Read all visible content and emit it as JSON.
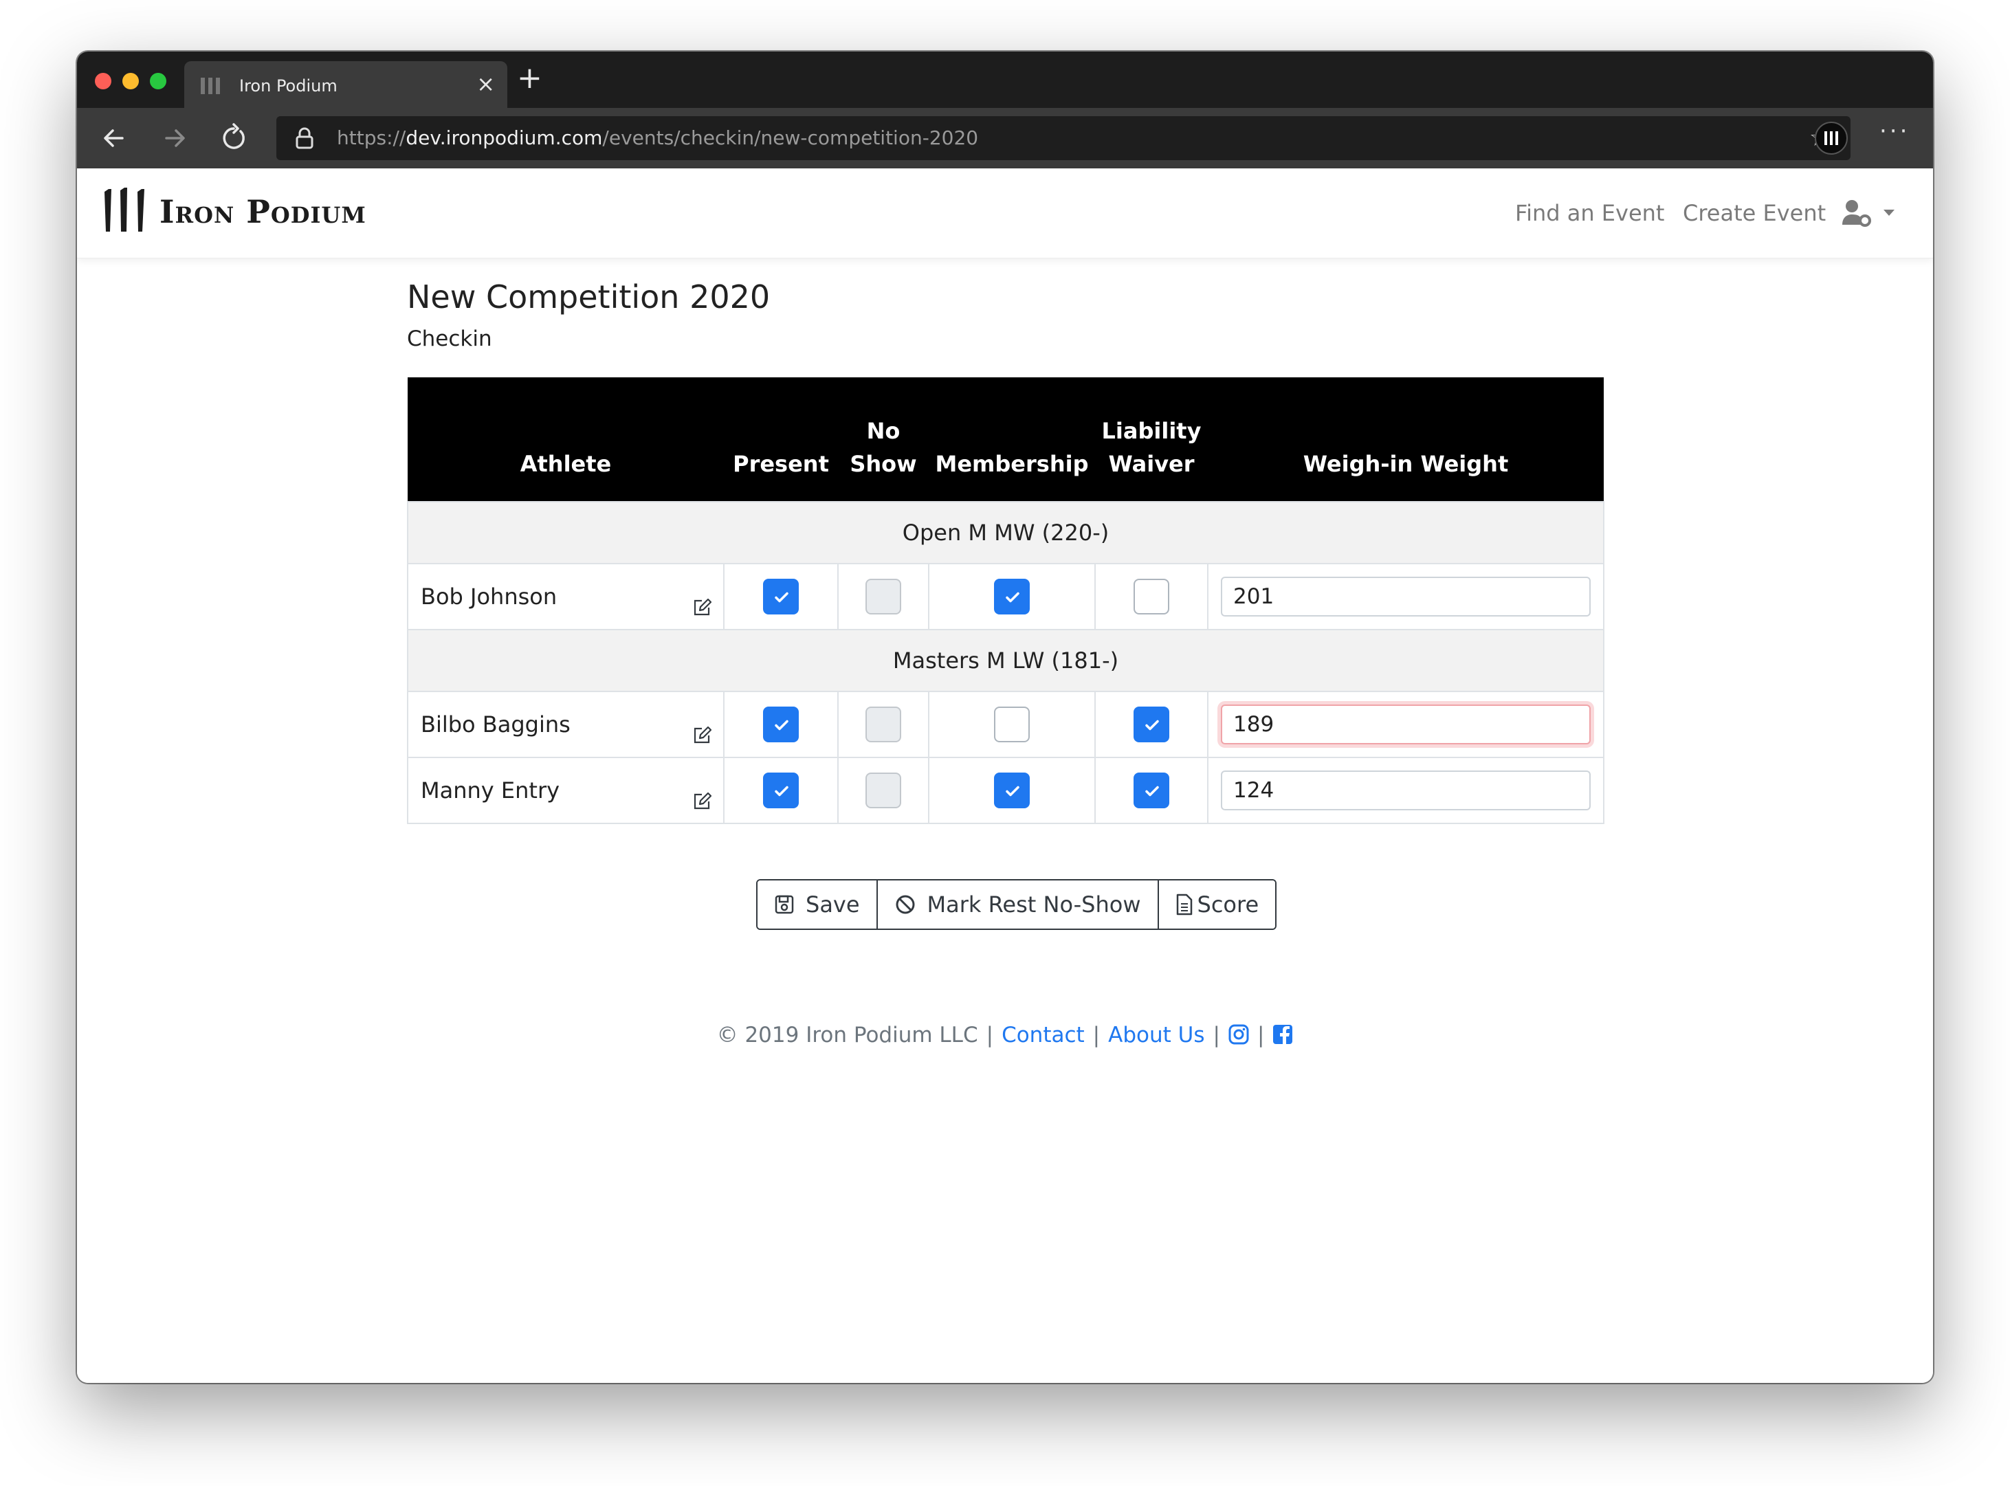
{
  "browser": {
    "tab_title": "Iron Podium",
    "url_scheme": "https://",
    "url_host": "dev.ironpodium.com",
    "url_path": "/events/checkin/new-competition-2020"
  },
  "navbar": {
    "brand": "Iron Podium",
    "find_event": "Find an Event",
    "create_event": "Create Event",
    "user_icon": "user-cog-icon"
  },
  "page": {
    "title": "New Competition 2020",
    "subtitle": "Checkin"
  },
  "table": {
    "headers": {
      "athlete": "Athlete",
      "present": "Present",
      "no_show_1": "No",
      "no_show_2": "Show",
      "membership": "Membership",
      "waiver_1": "Liability",
      "waiver_2": "Waiver",
      "weight": "Weigh-in Weight"
    },
    "groups": [
      {
        "name": "Open M MW (220-)",
        "athletes": [
          {
            "name": "Bob Johnson",
            "present": true,
            "no_show": false,
            "membership": true,
            "waiver": false,
            "weight": "201",
            "weight_invalid": false
          }
        ]
      },
      {
        "name": "Masters M LW (181-)",
        "athletes": [
          {
            "name": "Bilbo Baggins",
            "present": true,
            "no_show": false,
            "membership": false,
            "waiver": true,
            "weight": "189",
            "weight_invalid": true
          },
          {
            "name": "Manny Entry",
            "present": true,
            "no_show": false,
            "membership": true,
            "waiver": true,
            "weight": "124",
            "weight_invalid": false
          }
        ]
      }
    ]
  },
  "actions": {
    "save": "Save",
    "mark_rest": "Mark Rest No-Show",
    "score": "Score"
  },
  "footer": {
    "copyright": "© 2019 Iron Podium LLC",
    "contact": "Contact",
    "about": "About Us",
    "instagram_icon": "instagram-icon",
    "facebook_icon": "facebook-icon"
  },
  "colors": {
    "accent": "#1f78f0",
    "header_bg": "#000000",
    "invalid": "#e6505a"
  }
}
